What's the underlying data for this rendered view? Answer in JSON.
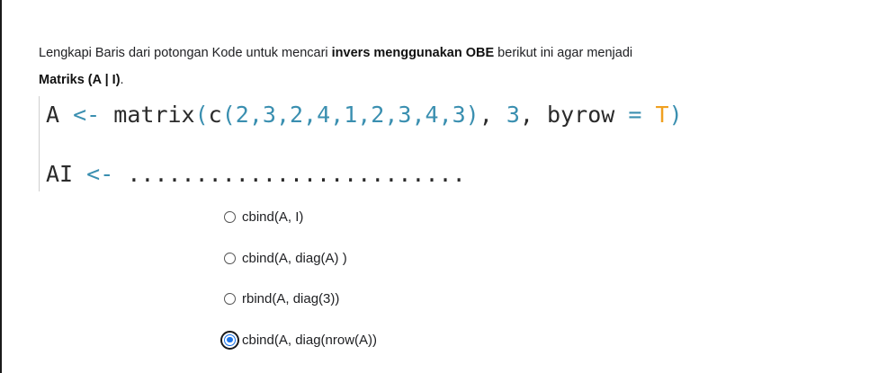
{
  "question": {
    "text_before": "Lengkapi Baris dari potongan Kode untuk mencari ",
    "bold_phrase": "invers menggunakan OBE",
    "text_after": " berikut ini agar menjadi",
    "bold_matrix": "Matriks (A | I)",
    "period": "."
  },
  "code": {
    "line1": {
      "var": "A",
      "assign": "<-",
      "func": "matrix",
      "open_paren": "(",
      "c_func": "c",
      "c_open": "(",
      "numbers": "2,3,2,4,1,2,3,4,3",
      "c_close": ")",
      "sep1": ",",
      "rows": "3",
      "sep2": ",",
      "byrow_arg": "byrow",
      "equals": "=",
      "byrow_val": "T",
      "close_paren": ")"
    },
    "line2": {
      "var": "AI",
      "assign": "<-",
      "blank": "........................."
    }
  },
  "options": [
    {
      "label": "cbind(A, I)",
      "selected": false
    },
    {
      "label": "cbind(A, diag(A) )",
      "selected": false
    },
    {
      "label": "rbind(A, diag(3))",
      "selected": false
    },
    {
      "label": "cbind(A, diag(nrow(A))",
      "selected": true
    }
  ],
  "colors": {
    "accent": "#1a73e8",
    "code_operator": "#3a8fb0",
    "code_constant": "#f0a020"
  }
}
